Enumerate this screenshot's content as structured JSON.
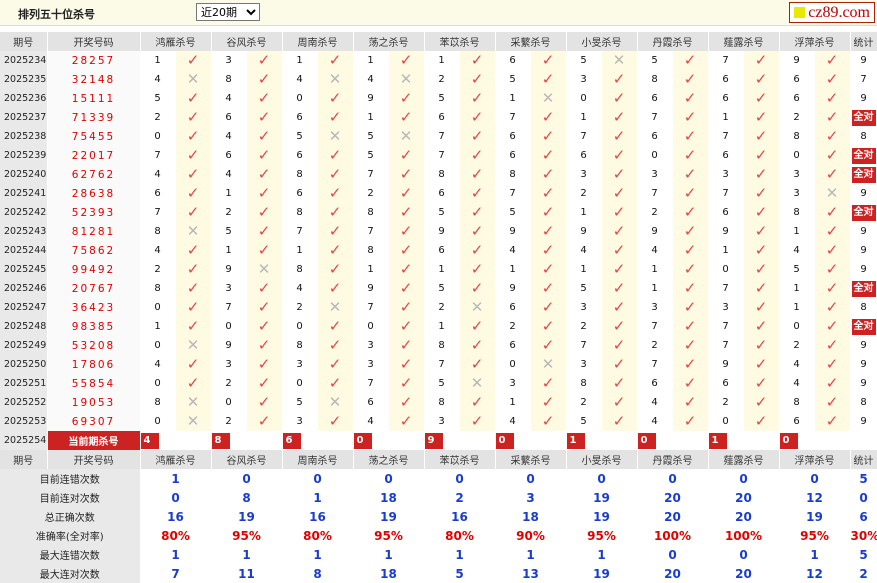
{
  "header": {
    "title": "排列五十位杀号",
    "period_select": "近20期",
    "logo": "cz89.com"
  },
  "columns": [
    "期号",
    "开奖号码",
    "鸿雁杀号",
    "谷风杀号",
    "周南杀号",
    "荡之杀号",
    "苯苡杀号",
    "采蘩杀号",
    "小旻杀号",
    "丹霞杀号",
    "薤露杀号",
    "浮萍杀号",
    "统计"
  ],
  "rows": [
    {
      "period": "2025234",
      "nums": "28257",
      "kills": [
        1,
        3,
        1,
        1,
        1,
        6,
        5,
        5,
        7,
        9
      ],
      "ok": [
        1,
        1,
        1,
        1,
        1,
        1,
        0,
        1,
        1,
        1
      ],
      "stat": "9",
      "all": false
    },
    {
      "period": "2025235",
      "nums": "32148",
      "kills": [
        4,
        8,
        4,
        4,
        2,
        5,
        3,
        8,
        6,
        6
      ],
      "ok": [
        0,
        1,
        0,
        0,
        1,
        1,
        1,
        1,
        1,
        1
      ],
      "stat": "7",
      "all": false
    },
    {
      "period": "2025236",
      "nums": "15111",
      "kills": [
        5,
        4,
        0,
        9,
        5,
        1,
        0,
        6,
        6,
        6
      ],
      "ok": [
        1,
        1,
        1,
        1,
        1,
        0,
        1,
        1,
        1,
        1
      ],
      "stat": "9",
      "all": false
    },
    {
      "period": "2025237",
      "nums": "71339",
      "kills": [
        2,
        6,
        6,
        1,
        6,
        7,
        1,
        7,
        1,
        2
      ],
      "ok": [
        1,
        1,
        1,
        1,
        1,
        1,
        1,
        1,
        1,
        1
      ],
      "stat": "全对",
      "all": true
    },
    {
      "period": "2025238",
      "nums": "75455",
      "kills": [
        0,
        4,
        5,
        5,
        7,
        6,
        7,
        6,
        7,
        8
      ],
      "ok": [
        1,
        1,
        0,
        0,
        1,
        1,
        1,
        1,
        1,
        1
      ],
      "stat": "8",
      "all": false
    },
    {
      "period": "2025239",
      "nums": "22017",
      "kills": [
        7,
        6,
        6,
        5,
        7,
        6,
        6,
        0,
        6,
        0
      ],
      "ok": [
        1,
        1,
        1,
        1,
        1,
        1,
        1,
        1,
        1,
        1
      ],
      "stat": "全对",
      "all": true
    },
    {
      "period": "2025240",
      "nums": "62762",
      "kills": [
        4,
        4,
        8,
        7,
        8,
        8,
        3,
        3,
        3,
        3
      ],
      "ok": [
        1,
        1,
        1,
        1,
        1,
        1,
        1,
        1,
        1,
        1
      ],
      "stat": "全对",
      "all": true
    },
    {
      "period": "2025241",
      "nums": "28638",
      "kills": [
        6,
        1,
        6,
        2,
        6,
        7,
        2,
        7,
        7,
        3
      ],
      "ok": [
        1,
        1,
        1,
        1,
        1,
        1,
        1,
        1,
        1,
        0
      ],
      "stat": "9",
      "all": false
    },
    {
      "period": "2025242",
      "nums": "52393",
      "kills": [
        7,
        2,
        8,
        8,
        5,
        5,
        1,
        2,
        6,
        8
      ],
      "ok": [
        1,
        1,
        1,
        1,
        1,
        1,
        1,
        1,
        1,
        1
      ],
      "stat": "全对",
      "all": true
    },
    {
      "period": "2025243",
      "nums": "81281",
      "kills": [
        8,
        5,
        7,
        7,
        9,
        9,
        9,
        9,
        9,
        1
      ],
      "ok": [
        0,
        1,
        1,
        1,
        1,
        1,
        1,
        1,
        1,
        1
      ],
      "stat": "9",
      "all": false
    },
    {
      "period": "2025244",
      "nums": "75862",
      "kills": [
        4,
        1,
        1,
        8,
        6,
        4,
        4,
        4,
        1,
        4
      ],
      "ok": [
        1,
        1,
        1,
        1,
        1,
        1,
        1,
        1,
        1,
        1
      ],
      "stat": "9",
      "all": false
    },
    {
      "period": "2025245",
      "nums": "99492",
      "kills": [
        2,
        9,
        8,
        1,
        1,
        1,
        1,
        1,
        0,
        5
      ],
      "ok": [
        1,
        0,
        1,
        1,
        1,
        1,
        1,
        1,
        1,
        1
      ],
      "stat": "9",
      "all": false
    },
    {
      "period": "2025246",
      "nums": "20767",
      "kills": [
        8,
        3,
        4,
        9,
        5,
        9,
        5,
        1,
        7,
        1
      ],
      "ok": [
        1,
        1,
        1,
        1,
        1,
        1,
        1,
        1,
        1,
        1
      ],
      "stat": "全对",
      "all": true
    },
    {
      "period": "2025247",
      "nums": "36423",
      "kills": [
        0,
        7,
        2,
        7,
        2,
        6,
        3,
        3,
        3,
        1
      ],
      "ok": [
        1,
        1,
        0,
        1,
        0,
        1,
        1,
        1,
        1,
        1
      ],
      "stat": "8",
      "all": false
    },
    {
      "period": "2025248",
      "nums": "98385",
      "kills": [
        1,
        0,
        0,
        0,
        1,
        2,
        2,
        7,
        7,
        0
      ],
      "ok": [
        1,
        1,
        1,
        1,
        1,
        1,
        1,
        1,
        1,
        1
      ],
      "stat": "全对",
      "all": true
    },
    {
      "period": "2025249",
      "nums": "53208",
      "kills": [
        0,
        9,
        8,
        3,
        8,
        6,
        7,
        2,
        7,
        2
      ],
      "ok": [
        0,
        1,
        1,
        1,
        1,
        1,
        1,
        1,
        1,
        1
      ],
      "stat": "9",
      "all": false
    },
    {
      "period": "2025250",
      "nums": "17806",
      "kills": [
        4,
        3,
        3,
        3,
        7,
        0,
        3,
        7,
        9,
        4
      ],
      "ok": [
        1,
        1,
        1,
        1,
        1,
        0,
        1,
        1,
        1,
        1
      ],
      "stat": "9",
      "all": false
    },
    {
      "period": "2025251",
      "nums": "55854",
      "kills": [
        0,
        2,
        0,
        7,
        5,
        3,
        8,
        6,
        6,
        4
      ],
      "ok": [
        1,
        1,
        1,
        1,
        0,
        1,
        1,
        1,
        1,
        1
      ],
      "stat": "9",
      "all": false
    },
    {
      "period": "2025252",
      "nums": "19053",
      "kills": [
        8,
        0,
        5,
        6,
        8,
        1,
        2,
        4,
        2,
        8
      ],
      "ok": [
        0,
        1,
        0,
        1,
        1,
        1,
        1,
        1,
        1,
        1
      ],
      "stat": "8",
      "all": false
    },
    {
      "period": "2025253",
      "nums": "69307",
      "kills": [
        0,
        2,
        3,
        4,
        3,
        4,
        5,
        4,
        0,
        6
      ],
      "ok": [
        0,
        1,
        1,
        1,
        1,
        1,
        1,
        1,
        1,
        1
      ],
      "stat": "9",
      "all": false
    }
  ],
  "current": {
    "period": "2025254",
    "label": "当前期杀号",
    "kills": [
      "4",
      "8",
      "6",
      "0",
      "9",
      "0",
      "1",
      "0",
      "1",
      "0"
    ]
  },
  "stats": [
    {
      "label": "目前连错次数",
      "values": [
        "1",
        "0",
        "0",
        "0",
        "0",
        "0",
        "0",
        "0",
        "0",
        "0",
        "5"
      ]
    },
    {
      "label": "目前连对次数",
      "values": [
        "0",
        "8",
        "1",
        "18",
        "2",
        "3",
        "19",
        "20",
        "20",
        "12",
        "0"
      ]
    },
    {
      "label": "总正确次数",
      "values": [
        "16",
        "19",
        "16",
        "19",
        "16",
        "18",
        "19",
        "20",
        "20",
        "19",
        "6"
      ]
    },
    {
      "label": "准确率(全对率)",
      "values": [
        "80%",
        "95%",
        "80%",
        "95%",
        "80%",
        "90%",
        "95%",
        "100%",
        "100%",
        "95%",
        "30%"
      ],
      "red": true
    },
    {
      "label": "最大连错次数",
      "values": [
        "1",
        "1",
        "1",
        "1",
        "1",
        "1",
        "1",
        "0",
        "0",
        "1",
        "5"
      ]
    },
    {
      "label": "最大连对次数",
      "values": [
        "7",
        "11",
        "8",
        "18",
        "5",
        "13",
        "19",
        "20",
        "20",
        "12",
        "2"
      ]
    }
  ],
  "colors": {
    "accent_red": "#cc2222",
    "number_red": "#e00000",
    "stat_blue": "#1a3ccc",
    "tick": "#e04848",
    "cross": "#b8b8b8"
  },
  "icons": {
    "correct": "check-icon",
    "wrong": "cross-icon"
  }
}
